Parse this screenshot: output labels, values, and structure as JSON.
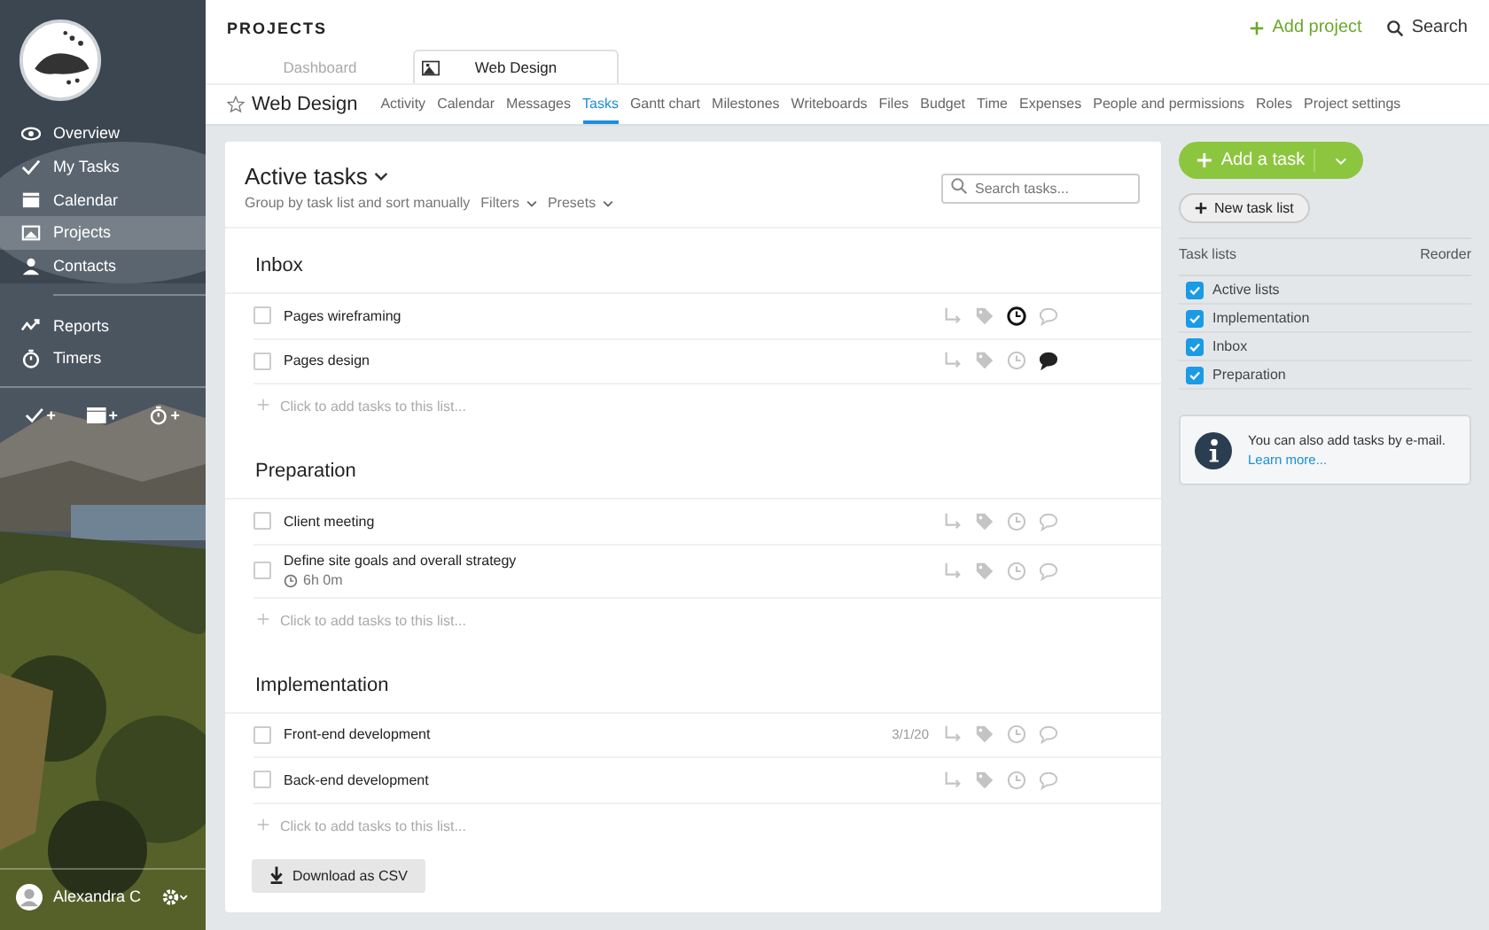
{
  "sidebar": {
    "nav": [
      {
        "label": "Overview",
        "kind": "eye",
        "selected": false
      },
      {
        "label": "My Tasks",
        "kind": "check",
        "selected": false
      },
      {
        "label": "Calendar",
        "kind": "calendar",
        "selected": false
      },
      {
        "label": "Projects",
        "kind": "projects",
        "selected": true
      },
      {
        "label": "Contacts",
        "kind": "person",
        "selected": false
      }
    ],
    "nav2": [
      {
        "label": "Reports",
        "kind": "reports",
        "selected": false
      },
      {
        "label": "Timers",
        "kind": "timer",
        "selected": false
      }
    ],
    "user": {
      "name": "Alexandra C"
    }
  },
  "header": {
    "title": "PROJECTS",
    "tabs": [
      {
        "label": "Dashboard",
        "selected": false
      },
      {
        "label": "Web Design",
        "selected": true
      }
    ],
    "add_project": "Add project",
    "search": "Search"
  },
  "project": {
    "name": "Web Design",
    "starred": false,
    "tabs": [
      {
        "label": "Activity",
        "selected": false
      },
      {
        "label": "Calendar",
        "selected": false
      },
      {
        "label": "Messages",
        "selected": false
      },
      {
        "label": "Tasks",
        "selected": true
      },
      {
        "label": "Gantt chart",
        "selected": false
      },
      {
        "label": "Milestones",
        "selected": false
      },
      {
        "label": "Writeboards",
        "selected": false
      },
      {
        "label": "Files",
        "selected": false
      },
      {
        "label": "Budget",
        "selected": false
      },
      {
        "label": "Time",
        "selected": false
      },
      {
        "label": "Expenses",
        "selected": false
      },
      {
        "label": "People and permissions",
        "selected": false
      },
      {
        "label": "Roles",
        "selected": false
      },
      {
        "label": "Project settings",
        "selected": false
      }
    ]
  },
  "tasks": {
    "title": "Active tasks",
    "group_by": "Group by task list and sort manually",
    "filters": "Filters",
    "presets": "Presets",
    "search_placeholder": "Search tasks...",
    "lists": [
      {
        "name": "Inbox",
        "add_text": "Click to add tasks to this list...",
        "tasks": [
          {
            "name": "Pages wireframing",
            "checked": false,
            "tracking": true,
            "commented": false
          },
          {
            "name": "Pages design",
            "checked": false,
            "tracking": false,
            "commented": true
          }
        ]
      },
      {
        "name": "Preparation",
        "add_text": "Click to add tasks to this list...",
        "tasks": [
          {
            "name": "Client meeting",
            "checked": false,
            "tracking": false,
            "commented": false
          },
          {
            "name": "Define site goals and overall strategy",
            "time": "6h 0m",
            "checked": false,
            "tracking": false,
            "commented": false
          }
        ]
      },
      {
        "name": "Implementation",
        "add_text": "Click to add tasks to this list...",
        "tasks": [
          {
            "name": "Front-end development",
            "date": "3/1/20",
            "checked": false,
            "tracking": false,
            "commented": false
          },
          {
            "name": "Back-end development",
            "checked": false,
            "tracking": false,
            "commented": false
          }
        ]
      }
    ],
    "download": "Download as CSV"
  },
  "side": {
    "add_task": "Add a task",
    "new_task_list": "New task list",
    "lists_label": "Task lists",
    "reorder": "Reorder",
    "lists": [
      {
        "label": "Active lists",
        "checked": true
      },
      {
        "label": "Implementation",
        "checked": true
      },
      {
        "label": "Inbox",
        "checked": true
      },
      {
        "label": "Preparation",
        "checked": true
      }
    ],
    "info": "You can also add tasks by e-mail.",
    "info_link": "Learn more..."
  }
}
